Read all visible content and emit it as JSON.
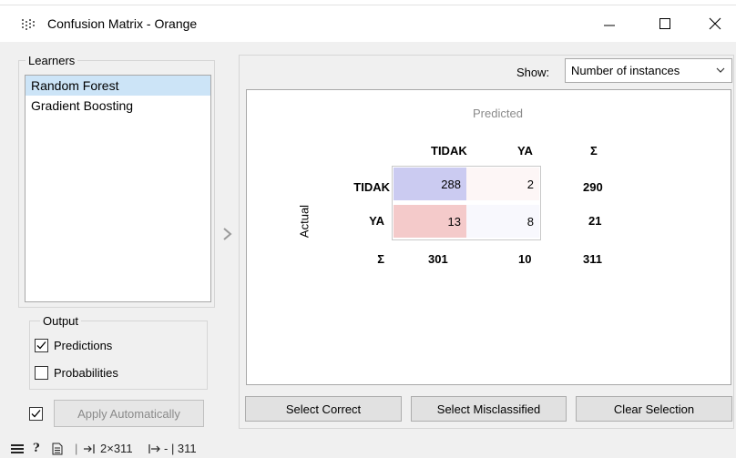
{
  "window": {
    "title": "Confusion Matrix - Orange",
    "minimize_glyph": "—",
    "close_glyph": "✕"
  },
  "learners": {
    "group_label": "Learners",
    "items": [
      "Random Forest",
      "Gradient Boosting"
    ],
    "selected_index": 0
  },
  "output": {
    "group_label": "Output",
    "predictions_label": "Predictions",
    "predictions_checked": true,
    "probabilities_label": "Probabilities",
    "probabilities_checked": false
  },
  "apply": {
    "label": "Apply Automatically",
    "checked": true
  },
  "show": {
    "label": "Show:",
    "value": "Number of instances"
  },
  "matrix": {
    "predicted_label": "Predicted",
    "actual_label": "Actual",
    "col_headers": [
      "TIDAK",
      "YA",
      "Σ"
    ],
    "row_headers": [
      "TIDAK",
      "YA",
      "Σ"
    ],
    "cells": [
      [
        "288",
        "2"
      ],
      [
        "13",
        "8"
      ]
    ],
    "row_sums": [
      "290",
      "21"
    ],
    "col_sums": [
      "301",
      "10"
    ],
    "total": "311",
    "cell_colors": [
      "#cbcbf1",
      "#fdf6f6",
      "#f4caca",
      "#f8f8fd"
    ]
  },
  "buttons": {
    "select_correct": "Select Correct",
    "select_misclassified": "Select Misclassified",
    "clear_selection": "Clear Selection"
  },
  "statusbar": {
    "menu_icon": "hamburger-icon",
    "help_icon": "help-icon",
    "report_icon": "report-icon",
    "input_summary": "2×311",
    "output_summary": "- | 311"
  }
}
